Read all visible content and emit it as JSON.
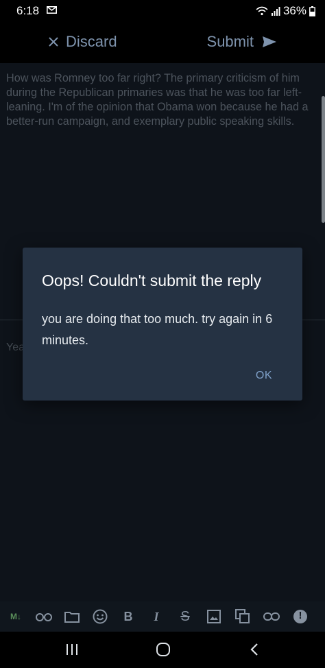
{
  "status": {
    "time": "6:18",
    "battery": "36%"
  },
  "appbar": {
    "discard_label": "Discard",
    "submit_label": "Submit"
  },
  "reply": {
    "quoted_text": "How was Romney too far right?  The primary criticism of him during the Republican primaries was that he was too far left-leaning.  I'm of the opinion that Obama won because he had a better-run campaign, and exemplary public speaking skills.",
    "draft_visible": "Yea"
  },
  "dialog": {
    "title": "Oops! Couldn't submit the reply",
    "message": "you are doing that too much. try again in 6 minutes.",
    "ok_label": "OK"
  },
  "toolbar": {
    "markdown_label": "M↓",
    "bold_label": "B",
    "italic_label": "I",
    "strike_label": "S",
    "alert_label": "!"
  },
  "colors": {
    "accent": "#7e93ad",
    "dialog_bg": "#253243",
    "background": "#141b24"
  }
}
